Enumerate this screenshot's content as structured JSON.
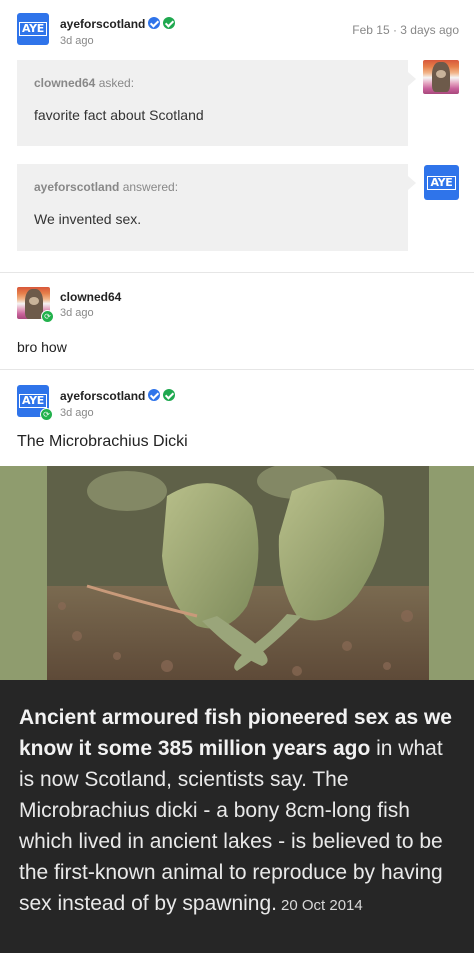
{
  "post1": {
    "username": "ayeforscotland",
    "time": "3d ago",
    "date": "Feb 15 · 3 days ago",
    "avatar_text": "AYE",
    "ask": {
      "asker": "clowned64",
      "asked_label": "asked:",
      "question": "favorite fact about Scotland"
    },
    "answer": {
      "answerer": "ayeforscotland",
      "answered_label": "answered:",
      "text": "We invented sex."
    }
  },
  "reply1": {
    "username": "clowned64",
    "time": "3d ago",
    "text": "bro how"
  },
  "reply2": {
    "username": "ayeforscotland",
    "time": "3d ago",
    "avatar_text": "AYE",
    "text": "The Microbrachius Dicki"
  },
  "caption": {
    "bold_text": "Ancient armoured fish pioneered sex as we know it some 385 million years ago",
    "body_text": " in what is now Scotland, scientists say. The Microbrachius dicki - a bony 8cm-long fish which lived in ancient lakes - is believed to be the first-known animal to reproduce by having sex instead of by spawning.",
    "date": "20 Oct 2014"
  },
  "icons": {
    "verified_blue": "verified-check-icon",
    "verified_green": "verified-check-icon",
    "repost": "reblog-icon"
  },
  "colors": {
    "brand_blue": "#2f74ea",
    "verified_green": "#1fa84f",
    "caption_bg": "#262626",
    "bubble_bg": "#f0f0f0"
  }
}
